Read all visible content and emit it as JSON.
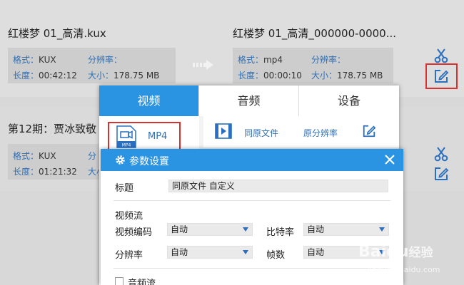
{
  "row1": {
    "source_name": "红楼梦 01_高清.kux",
    "output_name": "红楼梦 01_高清_000000-0000...",
    "source_info": {
      "format_label": "格式：",
      "format_value": "KUX",
      "resolution_label": "分辨率：",
      "resolution_value": "",
      "duration_label": "长度：",
      "duration_value": "00:42:12",
      "size_label": "大小：",
      "size_value": "178.75 MB"
    },
    "output_info": {
      "format_label": "格式：",
      "format_value": "mp4",
      "resolution_label": "分辨率：",
      "resolution_value": "",
      "duration_label": "长度：",
      "duration_value": "00:00:10",
      "size_label": "大小：",
      "size_value": "178.75 MB"
    }
  },
  "row2": {
    "source_name": "第12期：贾冰致敬",
    "source_info": {
      "format_label": "格式：",
      "format_value": "KUX",
      "resolution_label": "分",
      "duration_label": "长度：",
      "duration_value": "01:21:32",
      "size_label": "大小"
    }
  },
  "format_panel": {
    "tabs": [
      "视频",
      "音频",
      "设备"
    ],
    "active_tab": "视频",
    "selected_format": "MP4",
    "format_icon_caption": "MP4",
    "preset_name": "同原文件",
    "preset_resolution": "原分辨率"
  },
  "dialog": {
    "title": "参数设置",
    "title_label": "标题",
    "title_value": "同原文件 自定义",
    "video_section": "视频流",
    "video_codec_label": "视频编码",
    "video_codec_value": "自动",
    "bitrate_label": "比特率",
    "bitrate_value": "自动",
    "resolution_label": "分辨率",
    "resolution_value": "自动",
    "framerate_label": "帧数",
    "framerate_value": "自动",
    "audio_section": "音频流"
  },
  "watermark": {
    "brand": "Baidu",
    "brand_cn": "经验",
    "url": "jingyan.baidu.com"
  }
}
